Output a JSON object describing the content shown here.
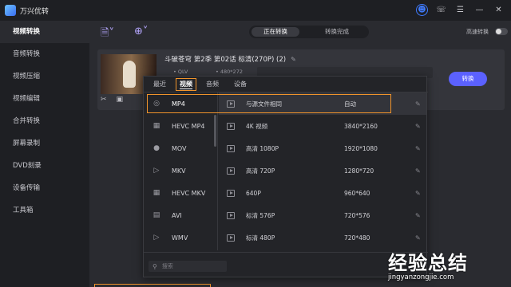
{
  "app": {
    "title": "万兴优转",
    "colors": {
      "accent": "#5b61ff",
      "highlight": "#f0932b",
      "bg": "#2a2b30",
      "sidebar": "#1e1f23"
    }
  },
  "titlebar": {
    "icons": [
      "user-icon",
      "headset-icon",
      "menu-icon",
      "minimize-icon",
      "close-icon"
    ]
  },
  "sidebar": {
    "items": [
      {
        "label": "视频转换",
        "active": true
      },
      {
        "label": "音频转换"
      },
      {
        "label": "视频压缩"
      },
      {
        "label": "视频编辑"
      },
      {
        "label": "合并转换"
      },
      {
        "label": "屏幕录制"
      },
      {
        "label": "DVD刻录"
      },
      {
        "label": "设备传输"
      },
      {
        "label": "工具箱"
      }
    ]
  },
  "toolbar": {
    "tabs": [
      "正在转换",
      "转换完成"
    ],
    "speed_label": "高速转换"
  },
  "file": {
    "title": "斗破苍穹 第2季 第02话 标清(270P) (2)",
    "meta_format": "• QLV",
    "meta_resolution": "• 480*272",
    "convert_label": "转换"
  },
  "popup": {
    "tabs": [
      "最近",
      "视频",
      "音频",
      "设备"
    ],
    "formats": [
      {
        "label": "MP4",
        "icon": "circle-icon"
      },
      {
        "label": "HEVC MP4",
        "icon": "hevc-icon"
      },
      {
        "label": "MOV",
        "icon": "circle-icon"
      },
      {
        "label": "MKV",
        "icon": "play-icon"
      },
      {
        "label": "HEVC MKV",
        "icon": "hevc-icon"
      },
      {
        "label": "AVI",
        "icon": "film-icon"
      },
      {
        "label": "WMV",
        "icon": "play-icon"
      }
    ],
    "resolutions": [
      {
        "name": "与源文件相同",
        "size": "自动"
      },
      {
        "name": "4K 视频",
        "size": "3840*2160"
      },
      {
        "name": "高清 1080P",
        "size": "1920*1080"
      },
      {
        "name": "高清 720P",
        "size": "1280*720"
      },
      {
        "name": "640P",
        "size": "960*640"
      },
      {
        "name": "标清 576P",
        "size": "720*576"
      },
      {
        "name": "标清 480P",
        "size": "720*480"
      }
    ],
    "search_placeholder": "搜索"
  },
  "watermark": {
    "main": "经验总结",
    "sub": "jingyanzongjie.com"
  }
}
